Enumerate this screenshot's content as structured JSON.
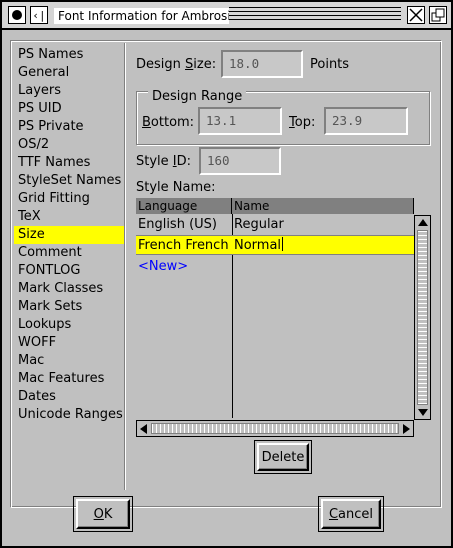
{
  "window": {
    "title": "Font Information for Ambrosia",
    "menu_glyph": "‹|"
  },
  "nav": {
    "items": [
      "PS Names",
      "General",
      "Layers",
      "PS UID",
      "PS Private",
      "OS/2",
      "TTF Names",
      "StyleSet Names",
      "Grid Fitting",
      "TeX",
      "Size",
      "Comment",
      "FONTLOG",
      "Mark Classes",
      "Mark Sets",
      "Lookups",
      "WOFF",
      "Mac",
      "Mac Features",
      "Dates",
      "Unicode Ranges"
    ],
    "selected": "Size"
  },
  "size": {
    "design_size_label_pre": "Design ",
    "design_size_label_u": "S",
    "design_size_label_post": "ize:",
    "design_size_value": "18.0",
    "design_size_unit": "Points",
    "range_title": "Design Range",
    "bottom_label_u": "B",
    "bottom_label_post": "ottom:",
    "bottom_value": "13.1",
    "top_label_u": "T",
    "top_label_post": "op:",
    "top_value": "23.9",
    "style_id_label_pre": "Style ",
    "style_id_label_u": "I",
    "style_id_label_post": "D:",
    "style_id_value": "160",
    "style_name_label": "Style Name:"
  },
  "table": {
    "headers": [
      "Language",
      "Name"
    ],
    "rows": [
      {
        "language": "English (US)",
        "name": "Regular"
      },
      {
        "language": "French French",
        "name": "Normal"
      }
    ],
    "new_label": "<New>"
  },
  "buttons": {
    "delete": "Delete",
    "ok_u": "O",
    "ok_post": "K",
    "cancel_u": "C",
    "cancel_post": "ancel"
  },
  "colors": {
    "selection": "#ffff00",
    "new_link": "#0000ff",
    "dialog_bg": "#c0c0c0"
  }
}
